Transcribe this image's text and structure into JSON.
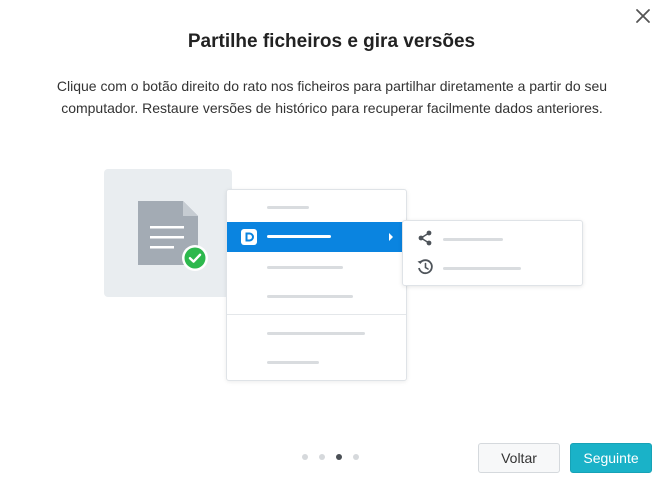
{
  "dialog": {
    "title": "Partilhe ficheiros e gira versões",
    "description": "Clique com o botão direito do rato nos ficheiros para partilhar diretamente a partir do seu computador. Restaure versões de histórico para recuperar facilmente dados anteriores.",
    "close_icon": "close-icon"
  },
  "illustration": {
    "file_icon": "document-icon",
    "badge_icon": "check-circle-icon",
    "app_icon": "app-logo-icon",
    "submenu_icons": [
      "share-icon",
      "history-icon"
    ]
  },
  "pagination": {
    "total": 4,
    "current": 3
  },
  "buttons": {
    "back_label": "Voltar",
    "next_label": "Seguinte"
  },
  "colors": {
    "accent": "#1ab2c8",
    "menu_highlight": "#0a84e0",
    "success": "#2db84d"
  }
}
